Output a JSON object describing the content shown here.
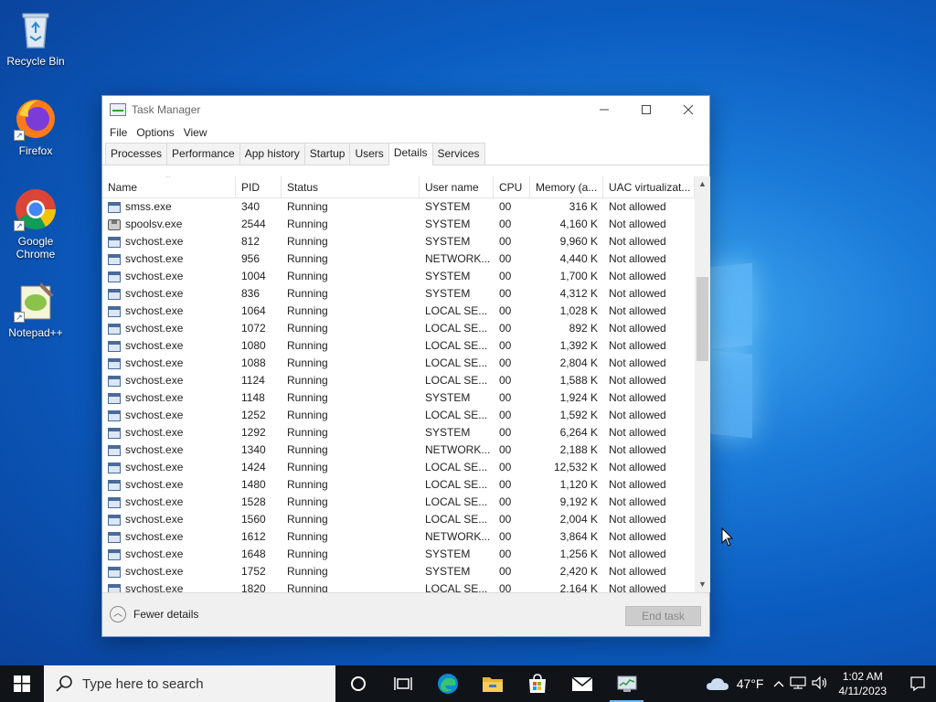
{
  "desktop": {
    "icons": [
      {
        "label": "Recycle Bin"
      },
      {
        "label": "Firefox"
      },
      {
        "label": "Google Chrome"
      },
      {
        "label": "Notepad++"
      }
    ]
  },
  "taskmanager": {
    "title": "Task Manager",
    "menu": [
      "File",
      "Options",
      "View"
    ],
    "tabs": [
      "Processes",
      "Performance",
      "App history",
      "Startup",
      "Users",
      "Details",
      "Services"
    ],
    "active_tab": "Details",
    "columns": [
      "Name",
      "PID",
      "Status",
      "User name",
      "CPU",
      "Memory (a...",
      "UAC virtualizat..."
    ],
    "rows": [
      {
        "name": "smss.exe",
        "pid": "340",
        "status": "Running",
        "user": "SYSTEM",
        "cpu": "00",
        "mem": "316 K",
        "uac": "Not allowed",
        "icon": "process-icon"
      },
      {
        "name": "spoolsv.exe",
        "pid": "2544",
        "status": "Running",
        "user": "SYSTEM",
        "cpu": "00",
        "mem": "4,160 K",
        "uac": "Not allowed",
        "icon": "printer-icon"
      },
      {
        "name": "svchost.exe",
        "pid": "812",
        "status": "Running",
        "user": "SYSTEM",
        "cpu": "00",
        "mem": "9,960 K",
        "uac": "Not allowed",
        "icon": "process-icon"
      },
      {
        "name": "svchost.exe",
        "pid": "956",
        "status": "Running",
        "user": "NETWORK...",
        "cpu": "00",
        "mem": "4,440 K",
        "uac": "Not allowed",
        "icon": "process-icon"
      },
      {
        "name": "svchost.exe",
        "pid": "1004",
        "status": "Running",
        "user": "SYSTEM",
        "cpu": "00",
        "mem": "1,700 K",
        "uac": "Not allowed",
        "icon": "process-icon"
      },
      {
        "name": "svchost.exe",
        "pid": "836",
        "status": "Running",
        "user": "SYSTEM",
        "cpu": "00",
        "mem": "4,312 K",
        "uac": "Not allowed",
        "icon": "process-icon"
      },
      {
        "name": "svchost.exe",
        "pid": "1064",
        "status": "Running",
        "user": "LOCAL SE...",
        "cpu": "00",
        "mem": "1,028 K",
        "uac": "Not allowed",
        "icon": "process-icon"
      },
      {
        "name": "svchost.exe",
        "pid": "1072",
        "status": "Running",
        "user": "LOCAL SE...",
        "cpu": "00",
        "mem": "892 K",
        "uac": "Not allowed",
        "icon": "process-icon"
      },
      {
        "name": "svchost.exe",
        "pid": "1080",
        "status": "Running",
        "user": "LOCAL SE...",
        "cpu": "00",
        "mem": "1,392 K",
        "uac": "Not allowed",
        "icon": "process-icon"
      },
      {
        "name": "svchost.exe",
        "pid": "1088",
        "status": "Running",
        "user": "LOCAL SE...",
        "cpu": "00",
        "mem": "2,804 K",
        "uac": "Not allowed",
        "icon": "process-icon"
      },
      {
        "name": "svchost.exe",
        "pid": "1124",
        "status": "Running",
        "user": "LOCAL SE...",
        "cpu": "00",
        "mem": "1,588 K",
        "uac": "Not allowed",
        "icon": "process-icon"
      },
      {
        "name": "svchost.exe",
        "pid": "1148",
        "status": "Running",
        "user": "SYSTEM",
        "cpu": "00",
        "mem": "1,924 K",
        "uac": "Not allowed",
        "icon": "process-icon"
      },
      {
        "name": "svchost.exe",
        "pid": "1252",
        "status": "Running",
        "user": "LOCAL SE...",
        "cpu": "00",
        "mem": "1,592 K",
        "uac": "Not allowed",
        "icon": "process-icon"
      },
      {
        "name": "svchost.exe",
        "pid": "1292",
        "status": "Running",
        "user": "SYSTEM",
        "cpu": "00",
        "mem": "6,264 K",
        "uac": "Not allowed",
        "icon": "process-icon"
      },
      {
        "name": "svchost.exe",
        "pid": "1340",
        "status": "Running",
        "user": "NETWORK...",
        "cpu": "00",
        "mem": "2,188 K",
        "uac": "Not allowed",
        "icon": "process-icon"
      },
      {
        "name": "svchost.exe",
        "pid": "1424",
        "status": "Running",
        "user": "LOCAL SE...",
        "cpu": "00",
        "mem": "12,532 K",
        "uac": "Not allowed",
        "icon": "process-icon"
      },
      {
        "name": "svchost.exe",
        "pid": "1480",
        "status": "Running",
        "user": "LOCAL SE...",
        "cpu": "00",
        "mem": "1,120 K",
        "uac": "Not allowed",
        "icon": "process-icon"
      },
      {
        "name": "svchost.exe",
        "pid": "1528",
        "status": "Running",
        "user": "LOCAL SE...",
        "cpu": "00",
        "mem": "9,192 K",
        "uac": "Not allowed",
        "icon": "process-icon"
      },
      {
        "name": "svchost.exe",
        "pid": "1560",
        "status": "Running",
        "user": "LOCAL SE...",
        "cpu": "00",
        "mem": "2,004 K",
        "uac": "Not allowed",
        "icon": "process-icon"
      },
      {
        "name": "svchost.exe",
        "pid": "1612",
        "status": "Running",
        "user": "NETWORK...",
        "cpu": "00",
        "mem": "3,864 K",
        "uac": "Not allowed",
        "icon": "process-icon"
      },
      {
        "name": "svchost.exe",
        "pid": "1648",
        "status": "Running",
        "user": "SYSTEM",
        "cpu": "00",
        "mem": "1,256 K",
        "uac": "Not allowed",
        "icon": "process-icon"
      },
      {
        "name": "svchost.exe",
        "pid": "1752",
        "status": "Running",
        "user": "SYSTEM",
        "cpu": "00",
        "mem": "2,420 K",
        "uac": "Not allowed",
        "icon": "process-icon"
      },
      {
        "name": "svchost.exe",
        "pid": "1820",
        "status": "Running",
        "user": "LOCAL SE...",
        "cpu": "00",
        "mem": "2,164 K",
        "uac": "Not allowed",
        "icon": "process-icon"
      }
    ],
    "footer": {
      "fewer_details": "Fewer details",
      "end_task": "End task"
    }
  },
  "taskbar": {
    "search_placeholder": "Type here to search",
    "weather_temp": "47°F",
    "time": "1:02 AM",
    "date": "4/11/2023"
  },
  "colors": {
    "accent": "#0078d7",
    "taskbar": "#101318"
  }
}
